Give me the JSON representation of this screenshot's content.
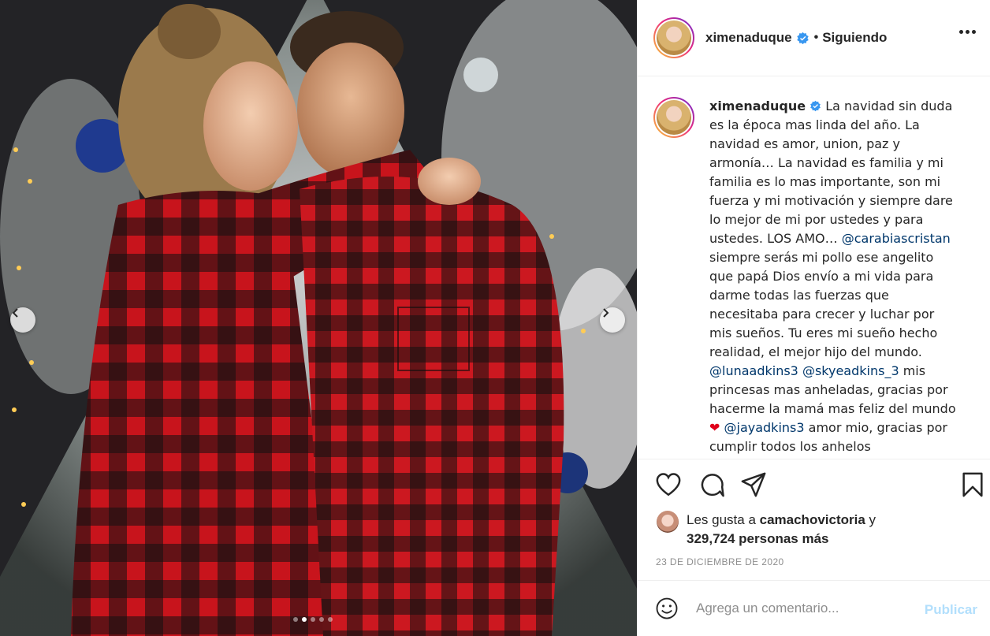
{
  "post": {
    "username": "ximenaduque",
    "follow_separator": "•",
    "follow_status": "Siguiendo",
    "caption_segments": [
      "La navidad sin duda es la época mas linda del año. La navidad es amor, union, paz y armonía… La navidad es familia y mi familia es lo mas importante, son mi fuerza y mi motivación y siempre dare lo mejor de mi por ustedes y para ustedes. LOS AMO… ",
      "@carabiascristan",
      " siempre serás mi pollo ese angelito que papá Dios envío a mi vida para darme todas las fuerzas que necesitaba para crecer y luchar por mis sueños. Tu eres mi sueño hecho realidad, el mejor hijo del mundo. ",
      "@lunaadkins3",
      " ",
      "@skyeadkins_3",
      " mis princesas mas anheladas, gracias por hacerme la mamá mas feliz del mundo ",
      "❤",
      " ",
      "@jayadkins3",
      " amor mio, gracias por cumplir todos los anhelos"
    ],
    "likes_prefix": "Les gusta a ",
    "likes_user": "camachovictoria",
    "likes_conjunction": " y",
    "likes_count": "329,724 personas más",
    "date": "23 DE DICIEMBRE DE 2020"
  },
  "comment": {
    "placeholder": "Agrega un comentario...",
    "publish_label": "Publicar"
  },
  "carousel": {
    "total": 5,
    "active": 1
  },
  "icons": {
    "verified": "verified-badge-icon",
    "more": "more-options-icon",
    "like": "heart-icon",
    "comment": "comment-icon",
    "share": "share-icon",
    "save": "bookmark-icon",
    "emoji": "emoji-icon",
    "prev": "chevron-left-icon",
    "next": "chevron-right-icon"
  },
  "colors": {
    "verified_blue": "#3897f0",
    "mention_blue": "#00376b",
    "publish_disabled": "#b2dffc",
    "muted_text": "#8e8e8e",
    "plaid_red": "#c8141c",
    "plaid_black": "#111111"
  }
}
